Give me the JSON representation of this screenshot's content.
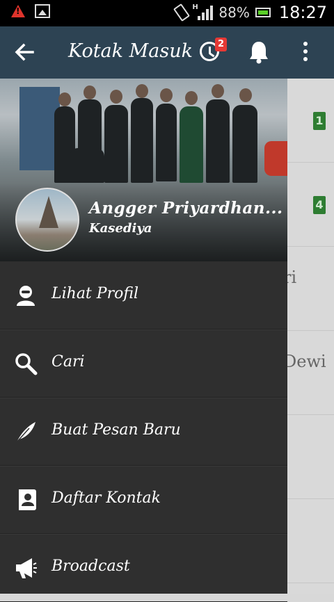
{
  "status_bar": {
    "network": "H",
    "battery": "88%",
    "time": "18:27"
  },
  "app_bar": {
    "title": "Kotak Masuk",
    "history_badge": "2"
  },
  "background_list": [
    {
      "count": "1"
    },
    {
      "count": "4"
    },
    {
      "fragment": "ri"
    },
    {
      "fragment": "Dewi"
    }
  ],
  "drawer": {
    "profile": {
      "name": "Angger Priyardhan...",
      "subtitle": "Kasediya"
    },
    "menu": [
      {
        "label": "Lihat Profil",
        "icon": "user-icon"
      },
      {
        "label": "Cari",
        "icon": "search-icon"
      },
      {
        "label": "Buat Pesan Baru",
        "icon": "feather-icon"
      },
      {
        "label": "Daftar Kontak",
        "icon": "contacts-icon"
      },
      {
        "label": "Broadcast",
        "icon": "megaphone-icon"
      }
    ]
  }
}
